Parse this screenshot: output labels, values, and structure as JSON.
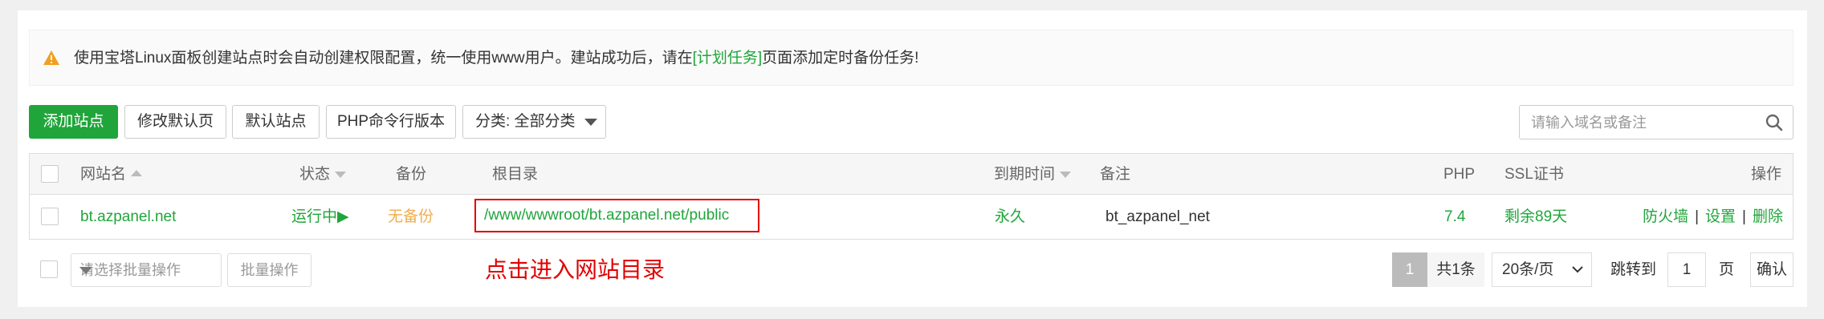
{
  "tip": {
    "text_before": "使用宝塔Linux面板创建站点时会自动创建权限配置，统一使用www用户。建站成功后，请在",
    "link": "[计划任务]",
    "text_after": "页面添加定时备份任务!",
    "icon": "warning-icon",
    "icon_color": "#f0a020"
  },
  "toolbar": {
    "add_site": "添加站点",
    "edit_default_page": "修改默认页",
    "default_site": "默认站点",
    "php_cli_version": "PHP命令行版本",
    "category_select": "分类: 全部分类"
  },
  "search": {
    "placeholder": "请输入域名或备注"
  },
  "table": {
    "headers": {
      "site_name": "网站名",
      "status": "状态",
      "backup": "备份",
      "root_dir": "根目录",
      "expire": "到期时间",
      "remark": "备注",
      "php": "PHP",
      "ssl": "SSL证书",
      "actions": "操作"
    },
    "rows": [
      {
        "site_name": "bt.azpanel.net",
        "status": "运行中▶",
        "backup": "无备份",
        "root_dir": "/www/wwwroot/bt.azpanel.net/public",
        "expire": "永久",
        "remark": "bt_azpanel_net",
        "php": "7.4",
        "ssl": "剩余89天",
        "action_firewall": "防火墙",
        "action_settings": "设置",
        "action_delete": "删除"
      }
    ]
  },
  "footer": {
    "batch_placeholder": "请选择批量操作",
    "batch_button": "批量操作",
    "annotation": "点击进入网站目录"
  },
  "pagination": {
    "current": "1",
    "total": "共1条",
    "page_size": "20条/页",
    "jump_label": "跳转到",
    "jump_value": "1",
    "page_unit": "页",
    "confirm": "确认"
  },
  "colors": {
    "accent": "#20a53a",
    "warning": "#f0ad4e",
    "highlight": "#e10000"
  }
}
